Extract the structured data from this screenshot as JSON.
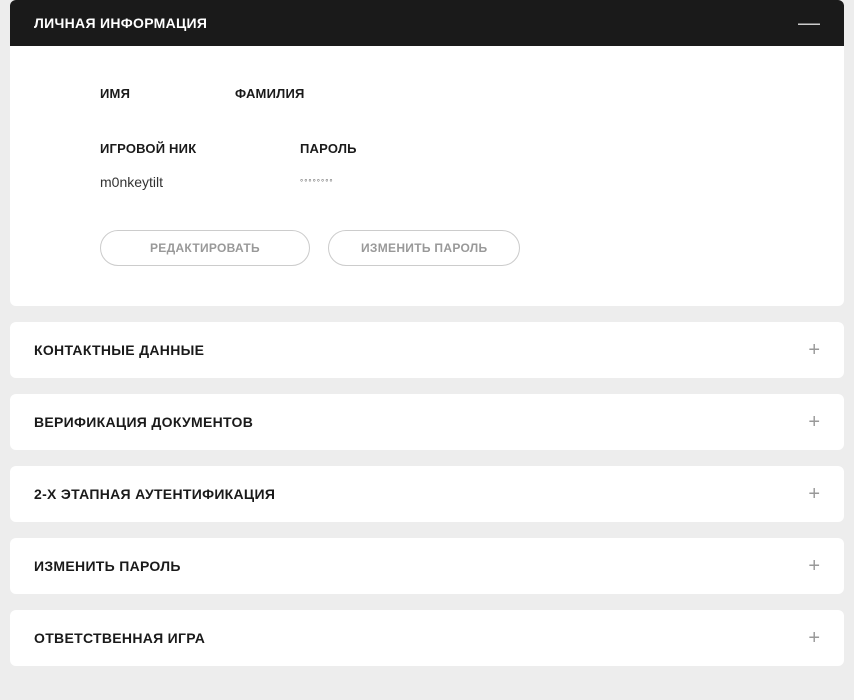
{
  "personalInfo": {
    "title": "ЛИЧНАЯ ИНФОРМАЦИЯ",
    "fields": {
      "firstName": {
        "label": "ИМЯ"
      },
      "lastName": {
        "label": "ФАМИЛИЯ"
      },
      "nickname": {
        "label": "ИГРОВОЙ НИК",
        "value": "m0nkeytilt"
      },
      "password": {
        "label": "ПАРОЛЬ",
        "value": "°°°°°°°°"
      }
    },
    "buttons": {
      "edit": "РЕДАКТИРОВАТЬ",
      "changePassword": "ИЗМЕНИТЬ ПАРОЛЬ"
    }
  },
  "sections": {
    "contactDetails": "КОНТАКТНЫЕ ДАННЫЕ",
    "documentVerification": "ВЕРИФИКАЦИЯ ДОКУМЕНТОВ",
    "twoFactorAuth": "2-Х ЭТАПНАЯ АУТЕНТИФИКАЦИЯ",
    "changePassword": "ИЗМЕНИТЬ ПАРОЛЬ",
    "responsibleGaming": "ОТВЕТСТВЕННАЯ ИГРА"
  },
  "icons": {
    "minus": "—",
    "plus": "+"
  }
}
